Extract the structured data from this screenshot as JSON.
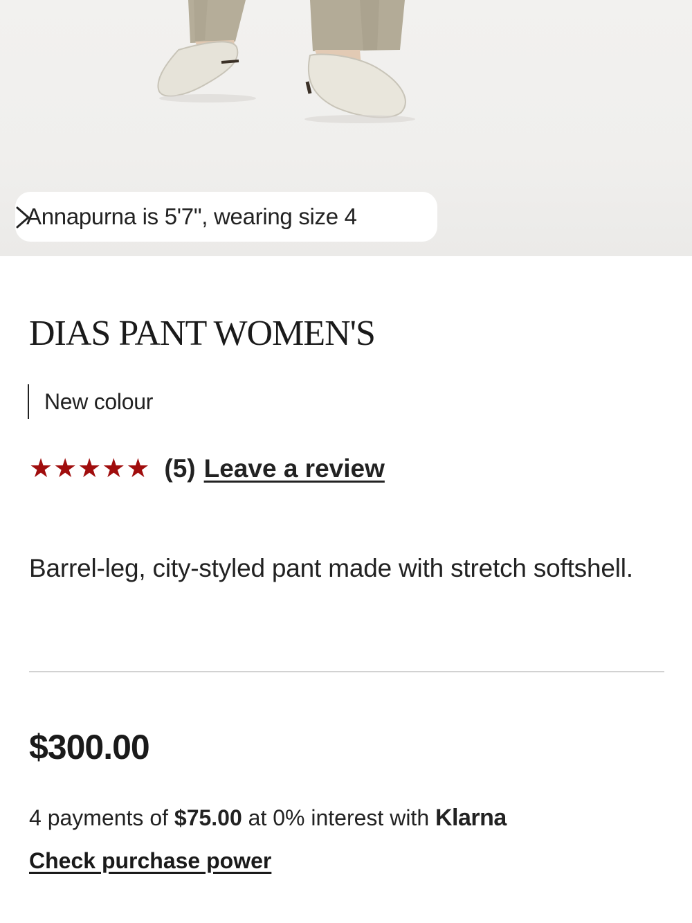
{
  "hero": {
    "image_alt": "model-legs-and-flats",
    "fit_note": "Annapurna is 5'7\", wearing size 4"
  },
  "product": {
    "title": "DIAS PANT WOMEN'S",
    "badge": "New colour",
    "rating": {
      "stars": 5,
      "count_label": "(5)",
      "review_link": "Leave a review"
    },
    "description": "Barrel-leg, city-styled pant made with stretch softshell.",
    "price": "$300.00"
  },
  "klarna": {
    "prefix": "4 payments of ",
    "amount": "$75.00",
    "middle": " at 0% interest with ",
    "brand": "Klarna",
    "link": "Check purchase power"
  },
  "colors": {
    "star": "#a00d0d",
    "text": "#1a1a1a",
    "divider": "#d2d2d2"
  },
  "icons": {
    "fit_chevron": "chevron-right-icon",
    "star": "star-icon"
  }
}
